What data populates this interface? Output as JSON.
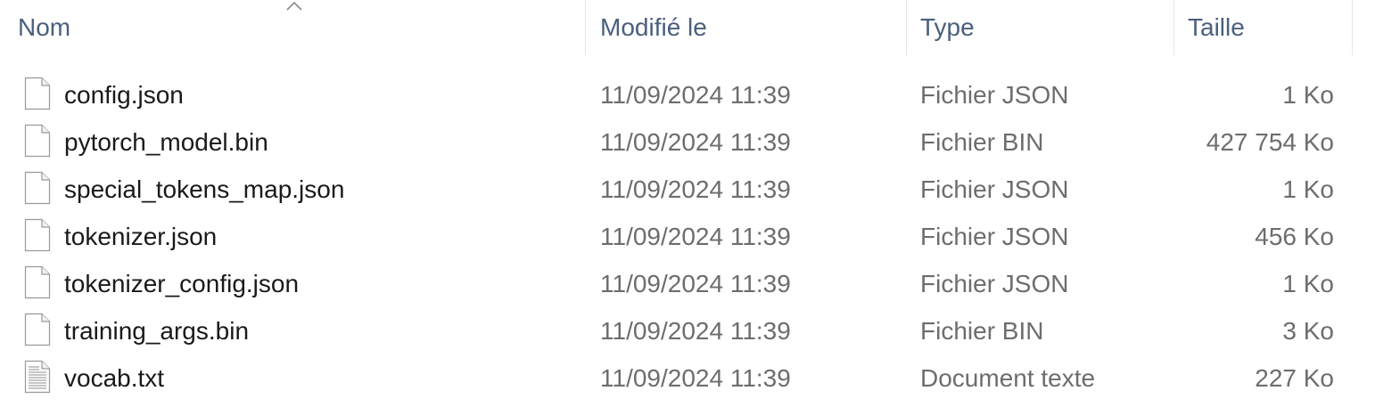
{
  "columns": {
    "name": "Nom",
    "modified": "Modifié le",
    "type": "Type",
    "size": "Taille"
  },
  "sort": {
    "column": "name",
    "direction": "ascending"
  },
  "files": [
    {
      "name": "config.json",
      "modified": "11/09/2024 11:39",
      "type": "Fichier JSON",
      "size": "1 Ko",
      "icon": "blank-file-icon"
    },
    {
      "name": "pytorch_model.bin",
      "modified": "11/09/2024 11:39",
      "type": "Fichier BIN",
      "size": "427 754 Ko",
      "icon": "blank-file-icon"
    },
    {
      "name": "special_tokens_map.json",
      "modified": "11/09/2024 11:39",
      "type": "Fichier JSON",
      "size": "1 Ko",
      "icon": "blank-file-icon"
    },
    {
      "name": "tokenizer.json",
      "modified": "11/09/2024 11:39",
      "type": "Fichier JSON",
      "size": "456 Ko",
      "icon": "blank-file-icon"
    },
    {
      "name": "tokenizer_config.json",
      "modified": "11/09/2024 11:39",
      "type": "Fichier JSON",
      "size": "1 Ko",
      "icon": "blank-file-icon"
    },
    {
      "name": "training_args.bin",
      "modified": "11/09/2024 11:39",
      "type": "Fichier BIN",
      "size": "3 Ko",
      "icon": "blank-file-icon"
    },
    {
      "name": "vocab.txt",
      "modified": "11/09/2024 11:39",
      "type": "Document texte",
      "size": "227 Ko",
      "icon": "text-file-icon"
    }
  ]
}
